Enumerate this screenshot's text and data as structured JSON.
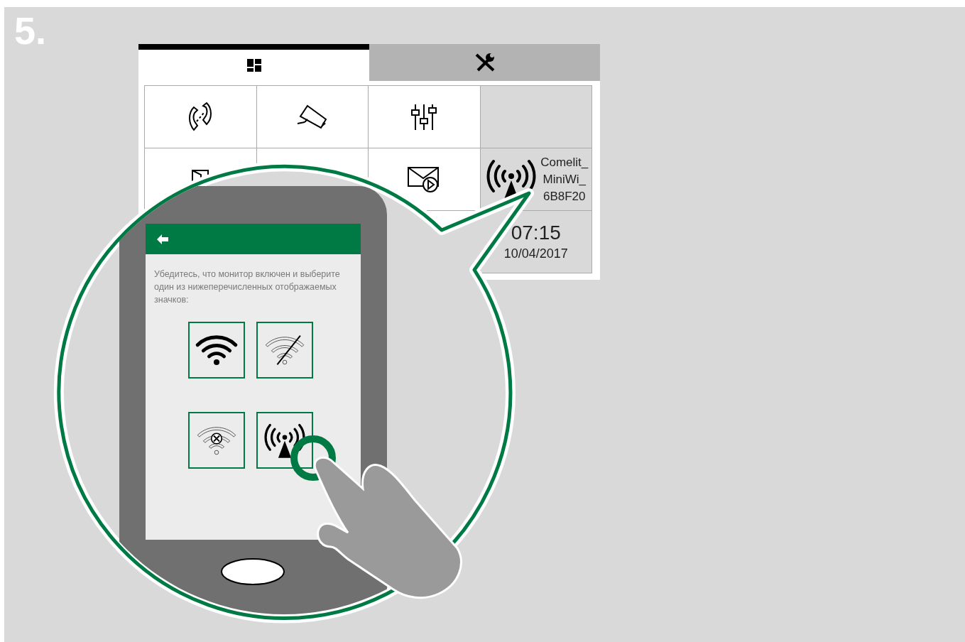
{
  "step": {
    "number": "5."
  },
  "monitor": {
    "tabs": [
      {
        "kind": "home",
        "selected": true
      },
      {
        "kind": "tools",
        "selected": false
      }
    ],
    "tiles": [
      {
        "kind": "call-divert",
        "shaded": false
      },
      {
        "kind": "camera",
        "shaded": false
      },
      {
        "kind": "sliders",
        "shaded": false
      },
      {
        "kind": "blank",
        "shaded": true
      },
      {
        "kind": "door",
        "shaded": false
      },
      {
        "kind": "blank"
      },
      {
        "kind": "video-message",
        "shaded": false
      },
      {
        "kind": "access-point",
        "shaded": true,
        "lines": [
          "Comelit_",
          "MiniWi_",
          "6B8F20"
        ]
      },
      {
        "kind": "blank"
      },
      {
        "kind": "blank"
      },
      {
        "kind": "blank",
        "shaded": false
      },
      {
        "kind": "clock",
        "shaded": true,
        "time": "07:15",
        "date": "10/04/2017"
      }
    ]
  },
  "phone": {
    "instruction": "Убедитесь, что монитор включен и выберите один из нижеперечисленных отображаемых значков:",
    "options": [
      {
        "kind": "wifi",
        "selected": false
      },
      {
        "kind": "wifi-off",
        "selected": false
      },
      {
        "kind": "wifi-error",
        "selected": false
      },
      {
        "kind": "access-point",
        "selected": true
      }
    ]
  }
}
